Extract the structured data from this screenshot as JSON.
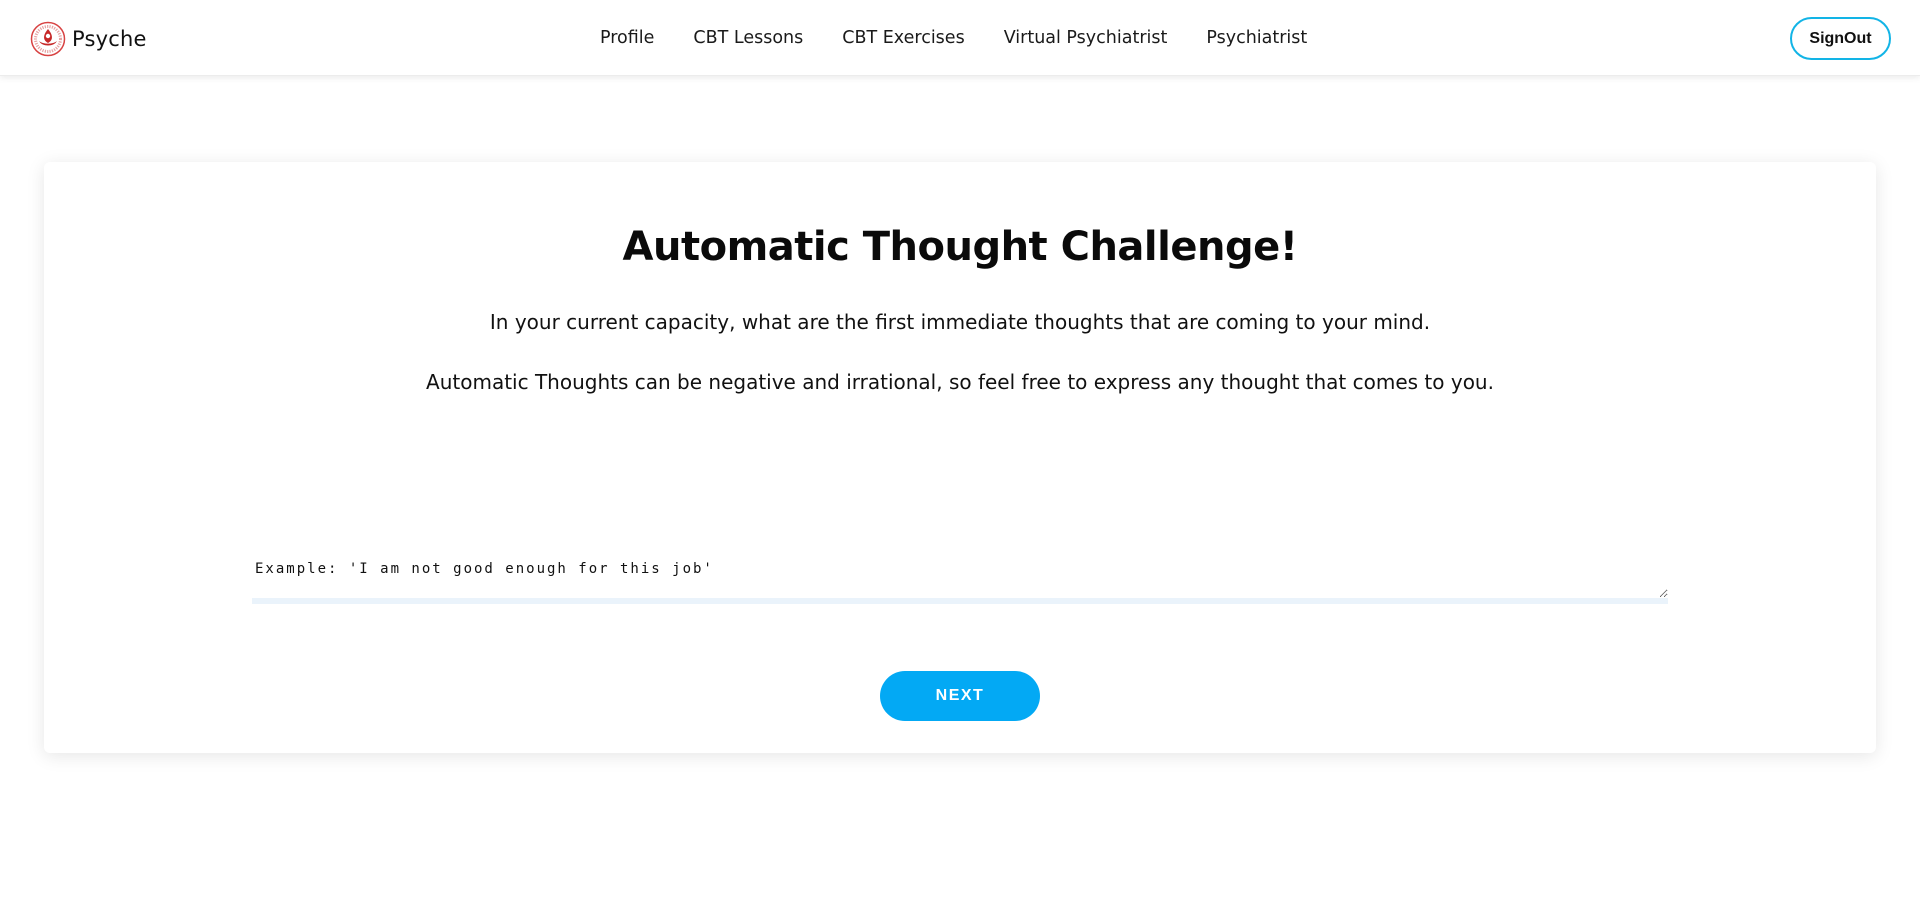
{
  "app": {
    "brand_name": "Psyche",
    "logo_icon": "psyche-logo-icon"
  },
  "nav": {
    "items": [
      {
        "label": "Profile"
      },
      {
        "label": "CBT Lessons"
      },
      {
        "label": "CBT Exercises"
      },
      {
        "label": "Virtual Psychiatrist"
      },
      {
        "label": "Psychiatrist"
      }
    ],
    "signout_label": "SignOut"
  },
  "challenge": {
    "title": "Automatic Thought Challenge!",
    "description_1": "In your current capacity, what are the first immediate thoughts that are coming to your mind.",
    "description_2": "Automatic Thoughts can be negative and irrational, so feel free to express any thought that comes to you.",
    "input_placeholder": "Example: 'I am not good enough for this job'",
    "input_value": "",
    "next_label": "NEXT"
  },
  "colors": {
    "accent": "#03a9f4",
    "signout_border": "#12b4e6",
    "logo_red": "#c62828"
  }
}
